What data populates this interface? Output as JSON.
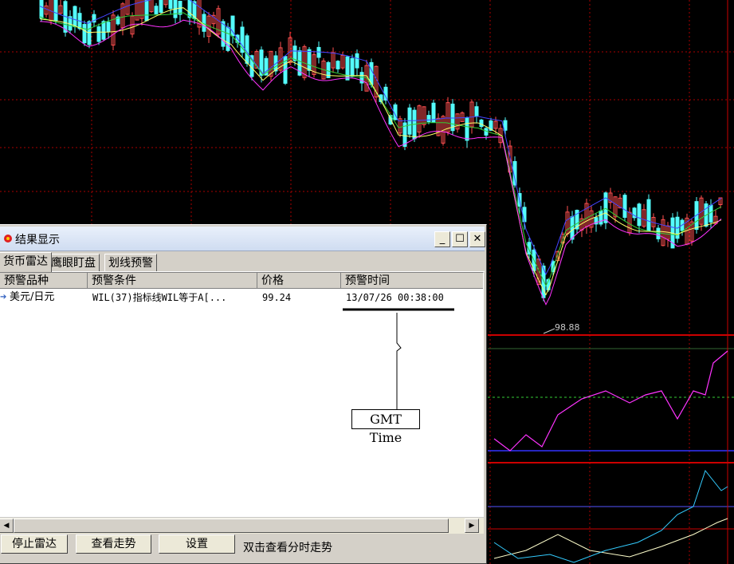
{
  "chart": {
    "low_label": "98.88",
    "colors": {
      "up": "#ff5050",
      "down": "#54fcfc",
      "ma_yellow": "#ffff66",
      "ma_green": "#33cc33",
      "ma_pink": "#ff33ff",
      "ma_blue": "#4444ff",
      "grid": "#aa0000"
    }
  },
  "dialog": {
    "title": "结果显示",
    "tabs": [
      {
        "label": "货币雷达"
      },
      {
        "label": "鹰眼盯盘"
      },
      {
        "label": "划线预警"
      }
    ],
    "columns": [
      "预警品种",
      "预警条件",
      "价格",
      "预警时间"
    ],
    "rows": [
      {
        "symbol": "美元/日元",
        "condition": "WIL(37)指标线WIL等于A[...",
        "price": "99.24",
        "time": "13/07/26 00:38:00"
      }
    ],
    "buttons": {
      "stop": "停止雷达",
      "view": "查看走势",
      "settings": "设置"
    },
    "hint": "双击查看分时走势"
  },
  "annotation": {
    "label": "GMT Time"
  }
}
